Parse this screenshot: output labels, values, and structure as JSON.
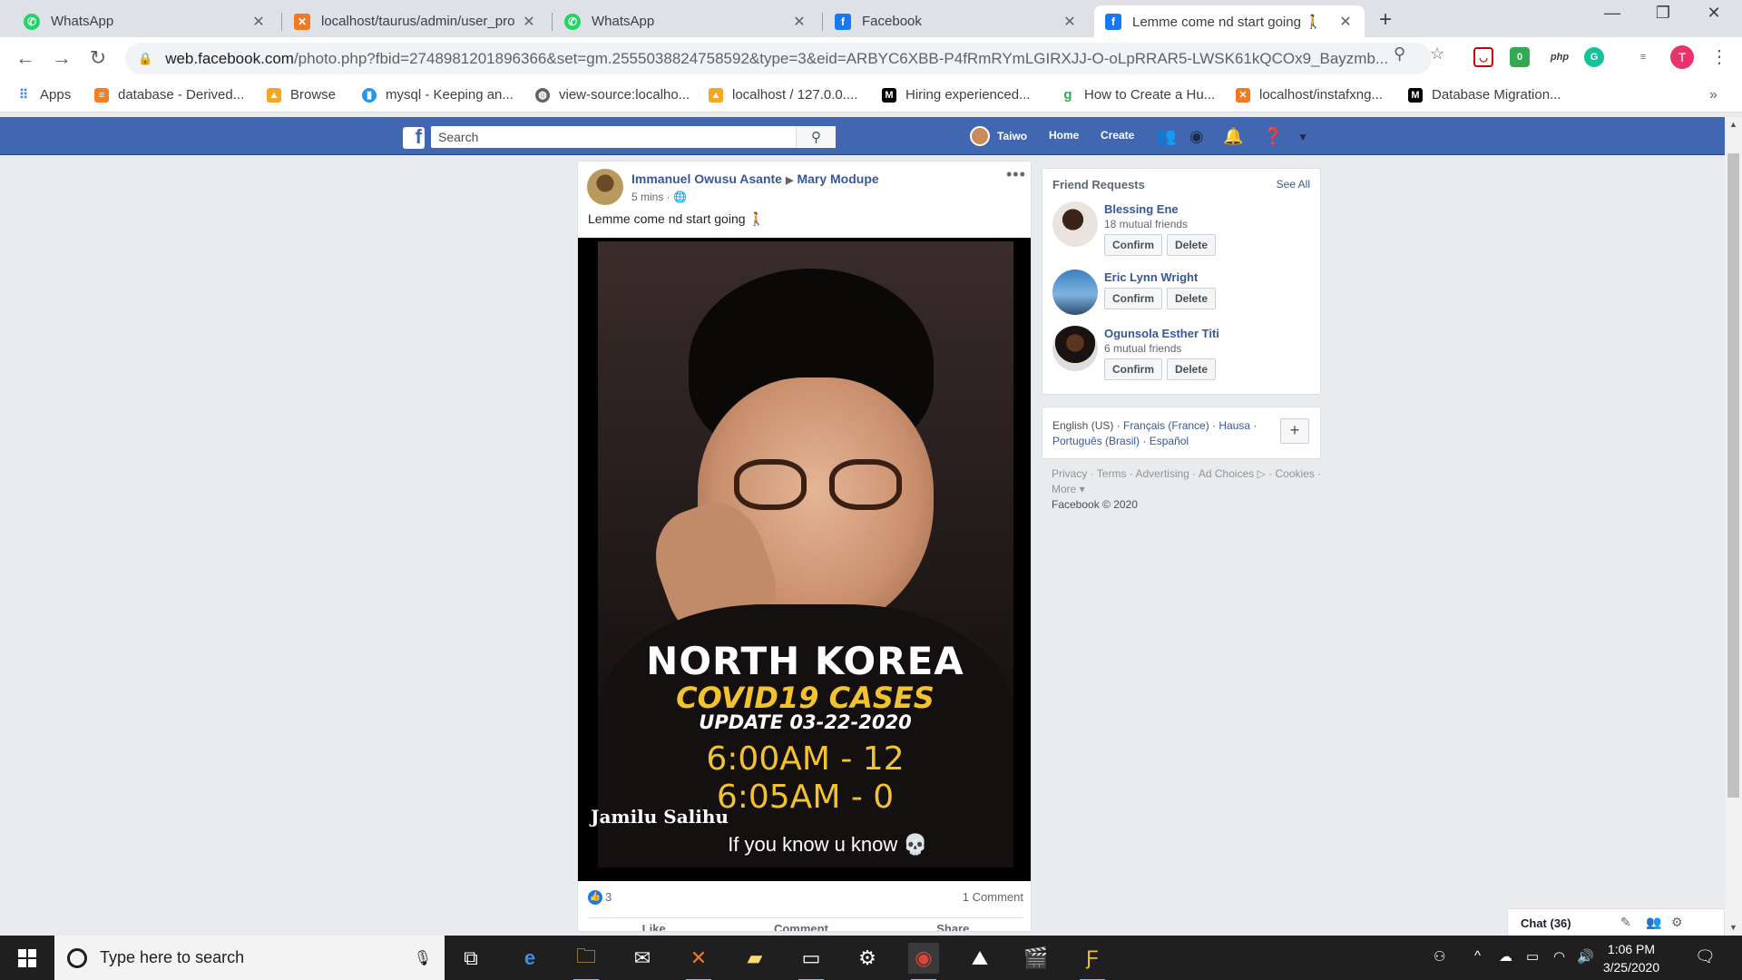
{
  "browser": {
    "tabs": [
      {
        "title": "WhatsApp",
        "icon": "whatsapp-icon"
      },
      {
        "title": "localhost/taurus/admin/user_pro",
        "icon": "xampp-icon"
      },
      {
        "title": "WhatsApp",
        "icon": "whatsapp-icon"
      },
      {
        "title": "Facebook",
        "icon": "facebook-icon"
      },
      {
        "title": "Lemme come nd start going 🚶",
        "icon": "facebook-icon",
        "active": true
      }
    ],
    "url_domain": "web.facebook.com",
    "url_rest": "/photo.php?fbid=2748981201896366&set=gm.2555038824758592&type=3&eid=ARBYC6XBB-P4fRmRYmLGIRXJJ-O-oLpRRAR5-LWSK61kQCOx9_Bayzmb...",
    "profile_initial": "T",
    "ext_badge": "0",
    "ext_php": "php",
    "bookmarks": [
      {
        "label": "Apps"
      },
      {
        "label": "database - Derived..."
      },
      {
        "label": "Browse"
      },
      {
        "label": "mysql - Keeping an..."
      },
      {
        "label": "view-source:localho..."
      },
      {
        "label": "localhost / 127.0.0...."
      },
      {
        "label": "Hiring experienced..."
      },
      {
        "label": "How to Create a Hu..."
      },
      {
        "label": "localhost/instafxng..."
      },
      {
        "label": "Database Migration..."
      }
    ],
    "more_bookmarks": "»"
  },
  "facebook": {
    "logo": "f",
    "search_placeholder": "Search",
    "user_name": "Taiwo",
    "nav": {
      "home": "Home",
      "create": "Create"
    },
    "post": {
      "author": "Immanuel Owusu Asante",
      "group": "Mary Modupe",
      "time": "5 mins · ",
      "privacy_glyph": "🌐",
      "text": "Lemme come nd start going 🚶",
      "image": {
        "line1": "NORTH KOREA",
        "line2": "COVID19 CASES",
        "line3": "UPDATE 03-22-2020",
        "line4": "6:00AM - 12",
        "line5": "6:05AM - 0",
        "credit": "Jamilu Salihu",
        "caption": "If you know u know 💀"
      },
      "likes": "3",
      "comments": "1 Comment",
      "actions": {
        "like": "Like",
        "comment": "Comment",
        "share": "Share"
      }
    },
    "friend_requests": {
      "title": "Friend Requests",
      "see_all": "See All",
      "confirm": "Confirm",
      "delete": "Delete",
      "items": [
        {
          "name": "Blessing Ene",
          "mutual": "18 mutual friends"
        },
        {
          "name": "Eric Lynn Wright",
          "mutual": ""
        },
        {
          "name": "Ogunsola Esther Titi",
          "mutual": "6 mutual friends"
        }
      ]
    },
    "languages": {
      "current": "English (US)",
      "others": [
        "Français (France)",
        "Hausa",
        "Português (Brasil)",
        "Español"
      ],
      "add": "+"
    },
    "footer": {
      "links": [
        "Privacy",
        "Terms",
        "Advertising",
        "Ad Choices ▷",
        "Cookies",
        "More ▾"
      ],
      "copyright": "Facebook © 2020"
    },
    "chat": {
      "label": "Chat (36)"
    }
  },
  "taskbar": {
    "search_placeholder": "Type here to search",
    "time": "1:06 PM",
    "date": "3/25/2020"
  },
  "colors": {
    "facebook_blue": "#4267b2",
    "link_blue": "#385898",
    "image_yellow": "#f2c230"
  }
}
